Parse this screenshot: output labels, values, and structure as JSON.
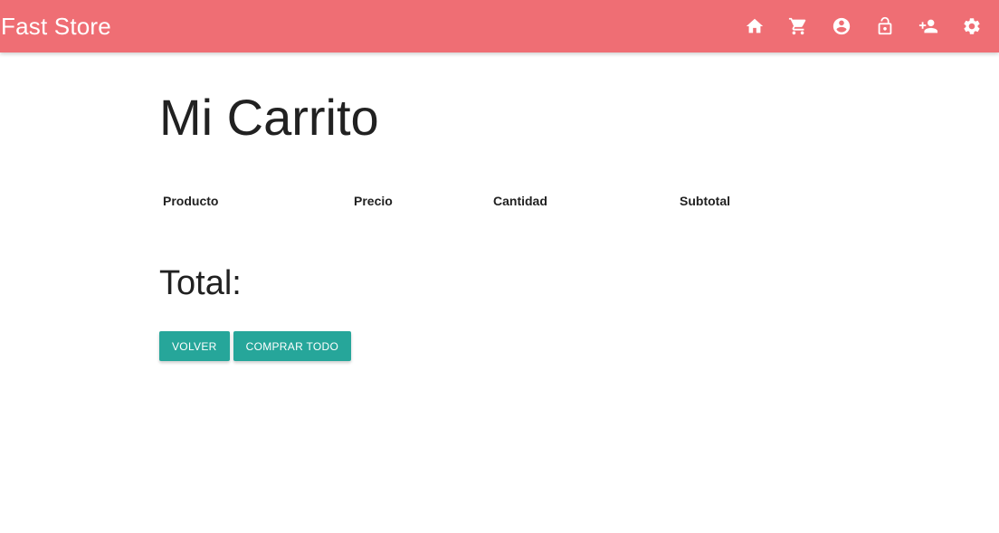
{
  "navbar": {
    "brand": "Fast Store",
    "background": "#ef6e74",
    "icons": [
      "home-icon",
      "cart-icon",
      "account-icon",
      "lock-open-icon",
      "person-add-icon",
      "gear-icon"
    ]
  },
  "main": {
    "title": "Mi Carrito",
    "table_headers": [
      "Producto",
      "Precio",
      "Cantidad",
      "Subtotal"
    ],
    "table_rows": [],
    "total_label": "Total:",
    "buttons": {
      "back_label": "VOLVER",
      "buy_all_label": "COMPRAR TODO",
      "color": "#26a69a"
    }
  }
}
